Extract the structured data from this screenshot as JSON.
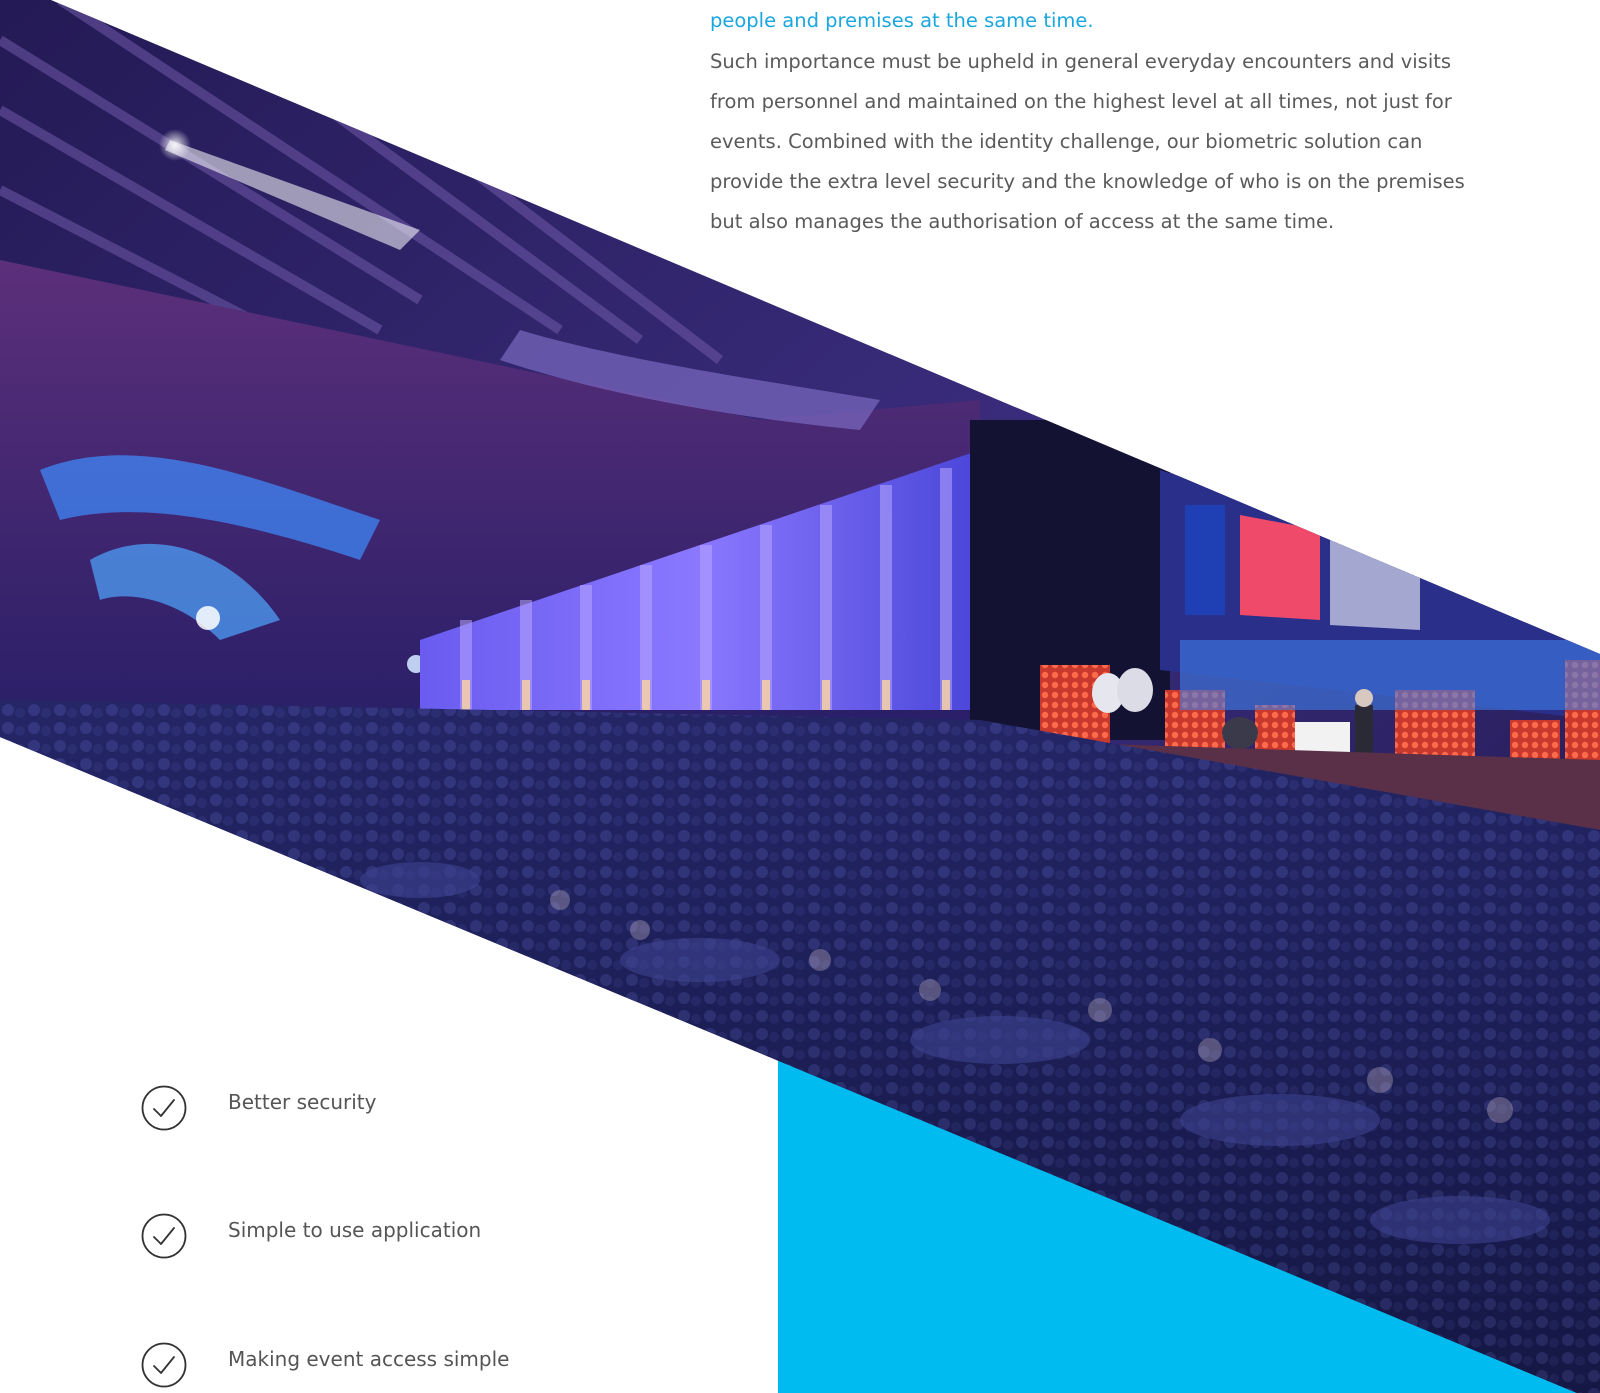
{
  "intro": {
    "lead": "people and premises at the same time.",
    "body": "Such importance must be upheld in general everyday encounters and visits from personnel and maintained on the highest level at all times, not just for events. Combined with the identity challenge, our biometric solution can provide the extra level security and the knowledge of who is on the premises but also manages the authorisation of access at the same time."
  },
  "features": [
    {
      "icon": "check-circle-icon",
      "label": "Better security"
    },
    {
      "icon": "check-circle-icon",
      "label": "Simple to use application"
    },
    {
      "icon": "check-circle-icon",
      "label": "Making event access simple"
    }
  ],
  "colors": {
    "accent_blue": "#00bbf0",
    "heading_blue": "#1aa6df",
    "body_text": "#5a5a5a"
  }
}
